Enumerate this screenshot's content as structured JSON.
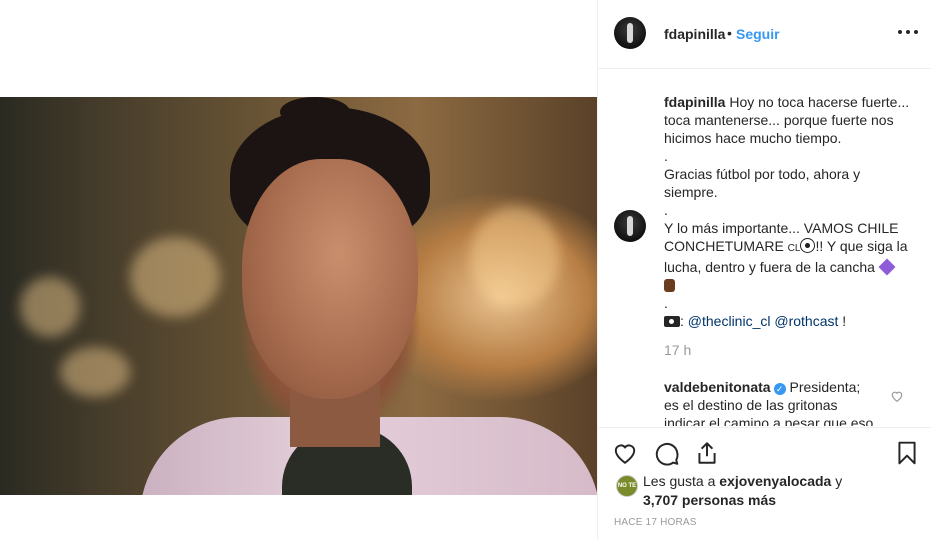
{
  "post": {
    "username": "fdapinilla",
    "separator": "•",
    "follow_label": "Seguir",
    "more_icon": "more-options-icon"
  },
  "caption": {
    "username": "fdapinilla",
    "line1": "Hoy no toca hacerse fuerte... toca mantenerse... porque fuerte nos hicimos hace mucho tiempo.",
    "dot1": ".",
    "line2": "Gracias fútbol por todo, ahora y siempre.",
    "dot2": ".",
    "line3a": "Y lo más importante... VAMOS CHILE CONCHETUMARE ",
    "line3_cl": "CL",
    "line3b": "!! Y que siga la lucha, dentro y fuera de la cancha",
    "dot3": ".",
    "credits_sep": ": ",
    "mention1": "@theclinic_cl",
    "mention2": "@rothcast",
    "credits_end": " !",
    "timestamp": "17 h"
  },
  "comment": {
    "username": "valdebenitonata",
    "verified_mark": "✓",
    "text": "Presidenta; es el destino de las gritonas indicar el camino a pesar que eso"
  },
  "likes": {
    "avatar_label": "NO TE",
    "prefix": "Les gusta a ",
    "user": "exjovenyalocada",
    "middle": " y ",
    "count": "3,707 personas más"
  },
  "posted_ago": "HACE 17 HORAS",
  "colors": {
    "link": "#3897f0",
    "text": "#262626",
    "muted": "#999999",
    "border": "#efefef"
  }
}
